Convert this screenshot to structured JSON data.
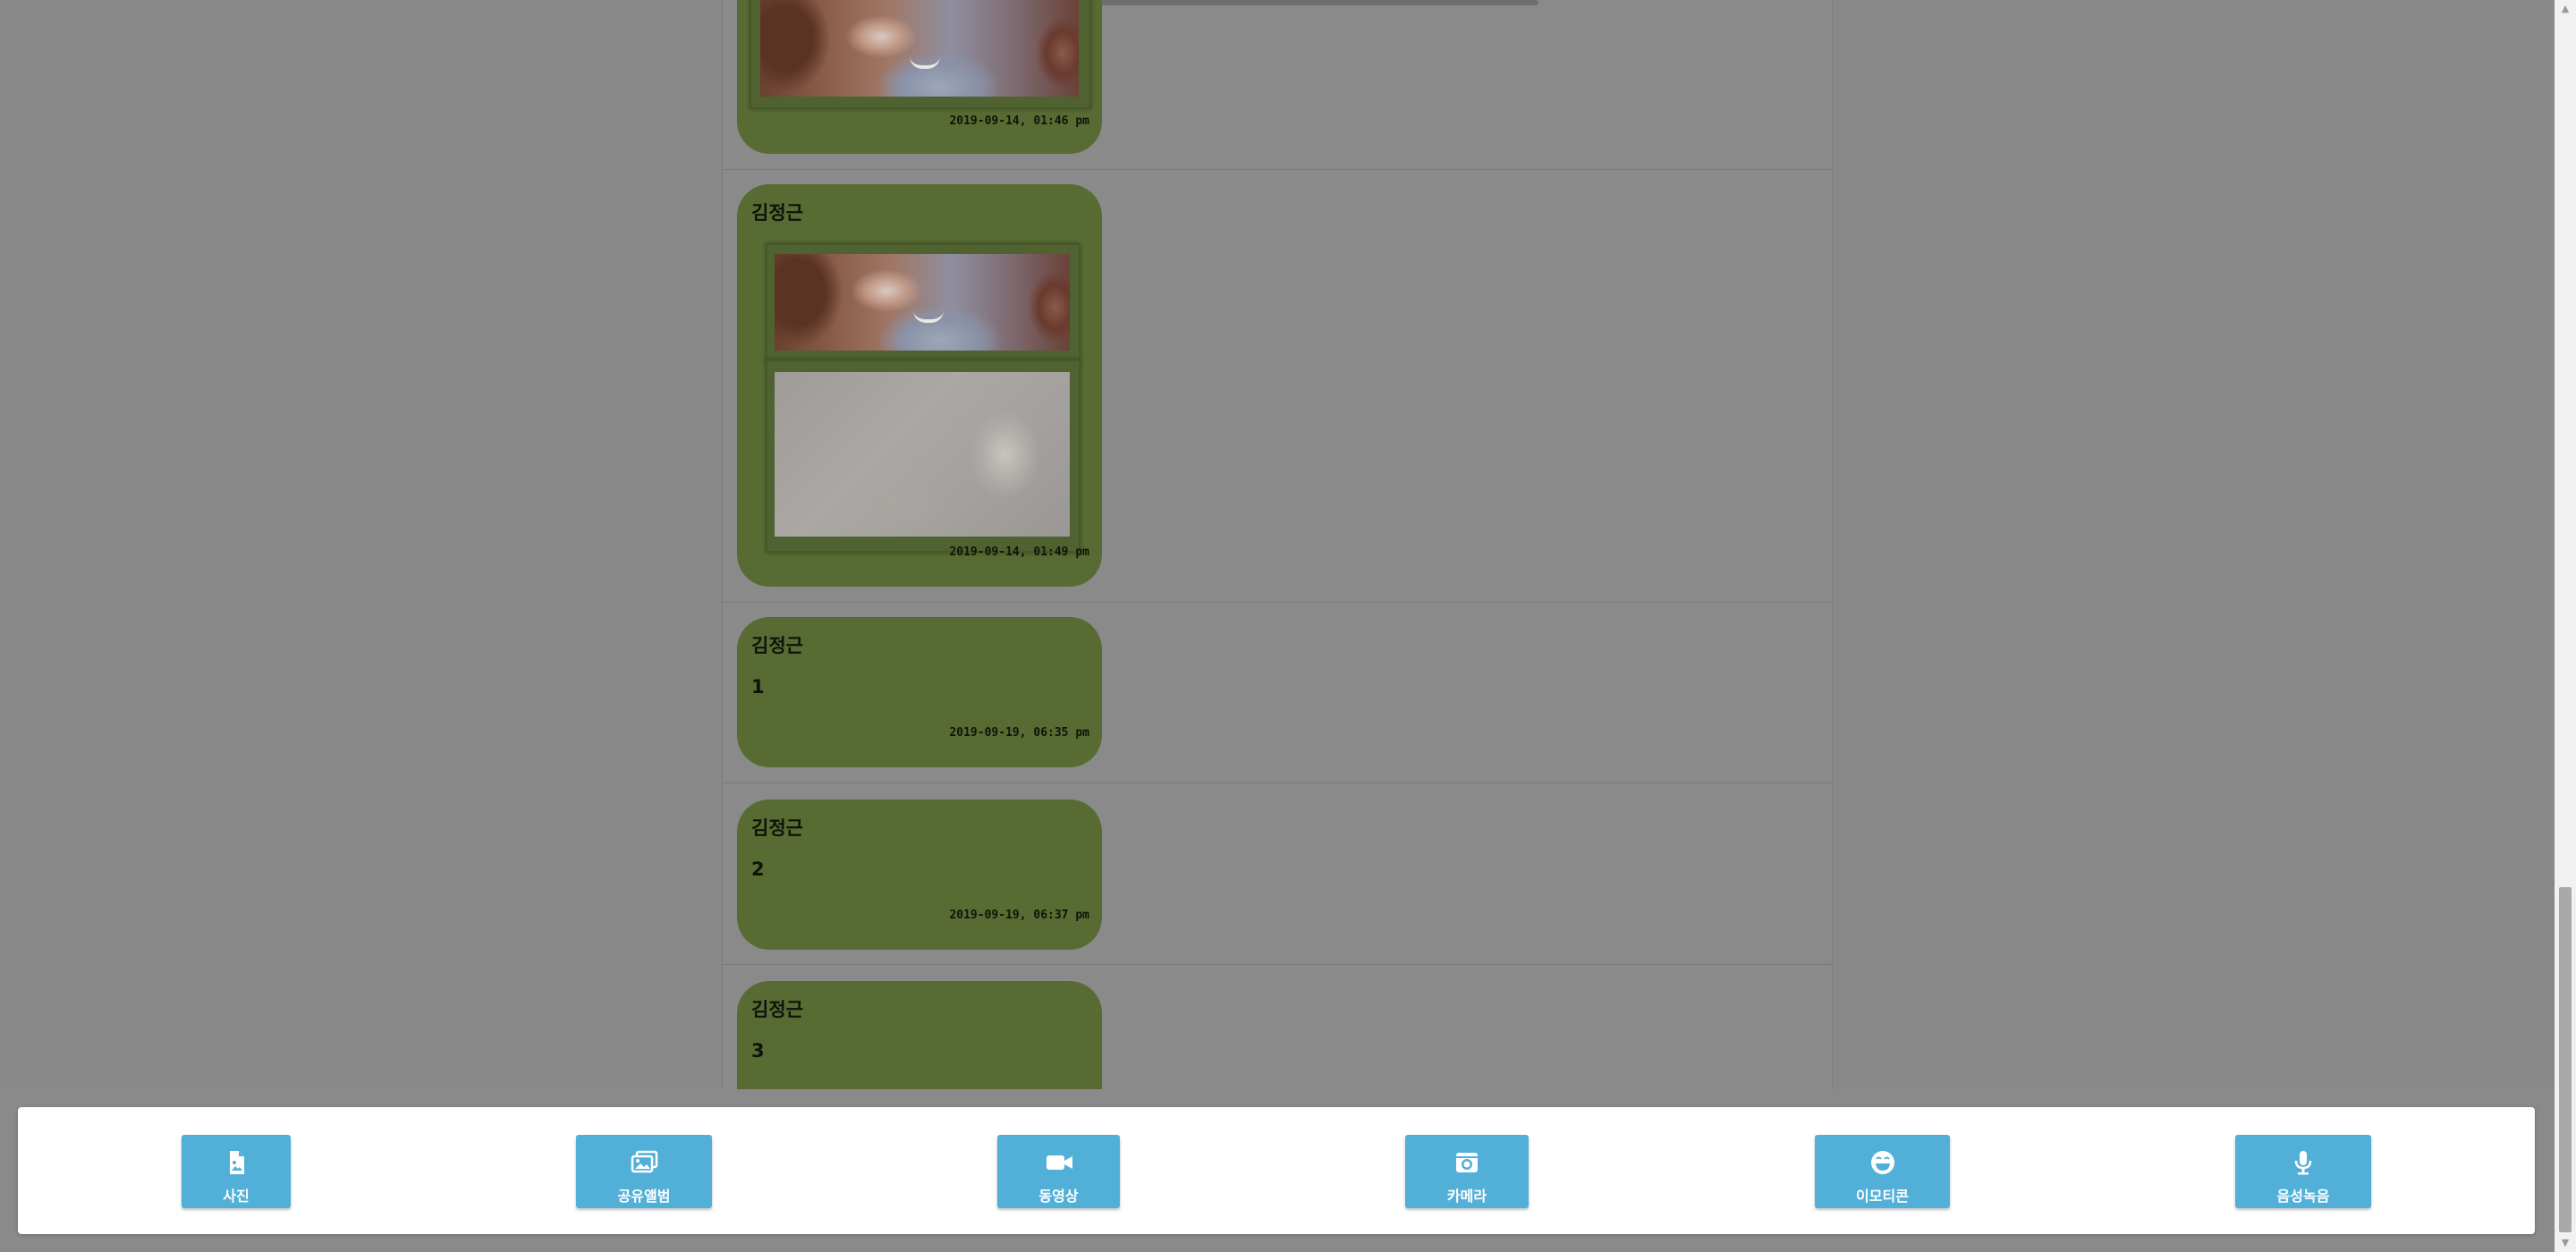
{
  "messages": [
    {
      "sender": "",
      "text": "",
      "timestamp": "2019-09-14, 01:46 pm",
      "photos": [
        "portrait"
      ]
    },
    {
      "sender": "김정근",
      "text": "",
      "timestamp": "2019-09-14, 01:49 pm",
      "photos": [
        "portrait",
        "light"
      ]
    },
    {
      "sender": "김정근",
      "text": "1",
      "timestamp": "2019-09-19, 06:35 pm",
      "photos": []
    },
    {
      "sender": "김정근",
      "text": "2",
      "timestamp": "2019-09-19, 06:37 pm",
      "photos": []
    },
    {
      "sender": "김정근",
      "text": "3",
      "timestamp": "",
      "photos": []
    }
  ],
  "toolbar": {
    "buttons": [
      {
        "label": "사진",
        "icon": "image-file-icon"
      },
      {
        "label": "공유앨범",
        "icon": "photo-album-icon"
      },
      {
        "label": "동영상",
        "icon": "video-camera-icon"
      },
      {
        "label": "카메라",
        "icon": "camera-icon"
      },
      {
        "label": "이모티콘",
        "icon": "smiley-icon"
      },
      {
        "label": "음성녹음",
        "icon": "microphone-icon"
      }
    ]
  },
  "colors": {
    "bubble": "#586b33",
    "button": "#52b0d8",
    "overlay_background": "#888888"
  }
}
